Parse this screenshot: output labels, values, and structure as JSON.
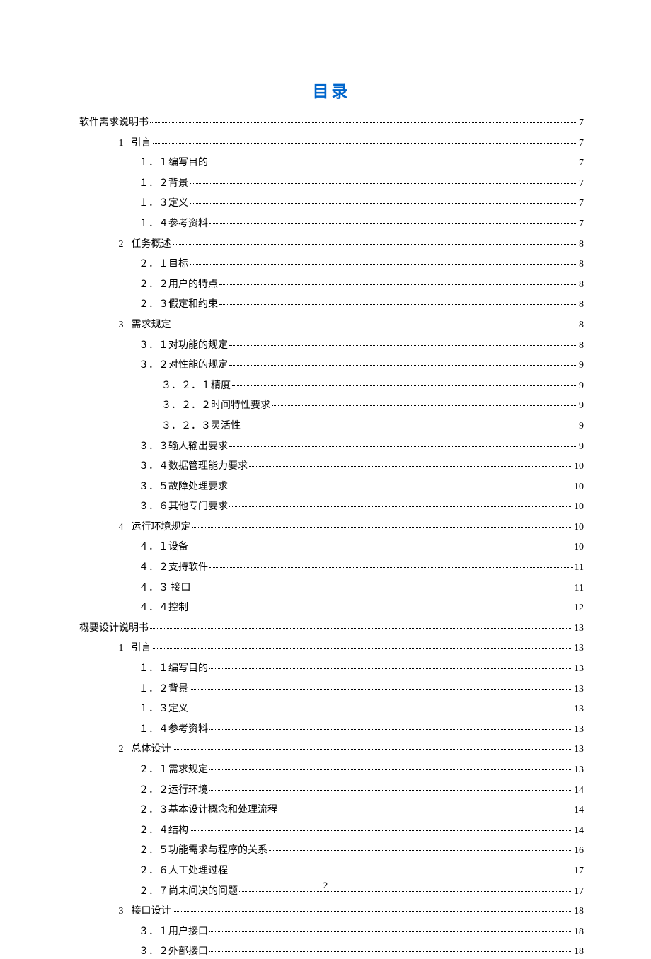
{
  "title": "目录",
  "page_number": "2",
  "entries": [
    {
      "level": 0,
      "label": "软件需求说明书",
      "page": "7"
    },
    {
      "level": 1,
      "num": "1",
      "label": "引言",
      "page": "7"
    },
    {
      "level": 2,
      "label": "１．１编写目的",
      "page": "7"
    },
    {
      "level": 2,
      "label": "１．２背景",
      "page": "7"
    },
    {
      "level": 2,
      "label": "１．３定义",
      "page": "7"
    },
    {
      "level": 2,
      "label": "１．４参考资料",
      "page": "7"
    },
    {
      "level": 1,
      "num": "2",
      "label": "任务概述",
      "page": "8"
    },
    {
      "level": 2,
      "label": "２．１目标",
      "page": "8"
    },
    {
      "level": 2,
      "label": "２．２用户的特点",
      "page": "8"
    },
    {
      "level": 2,
      "label": "２．３假定和约束",
      "page": "8"
    },
    {
      "level": 1,
      "num": "3",
      "label": "需求规定",
      "page": "8"
    },
    {
      "level": 2,
      "label": "３．１对功能的规定",
      "page": "8"
    },
    {
      "level": 2,
      "label": "３．２对性能的规定",
      "page": "9"
    },
    {
      "level": 3,
      "label": "３．２．１精度",
      "page": "9"
    },
    {
      "level": 3,
      "label": "３．２．２时间特性要求",
      "page": "9"
    },
    {
      "level": 3,
      "label": "３．２．３灵活性",
      "page": "9"
    },
    {
      "level": 2,
      "label": "３．３输人输出要求",
      "page": "9"
    },
    {
      "level": 2,
      "label": "３．４数据管理能力要求",
      "page": "10"
    },
    {
      "level": 2,
      "label": "３．５故障处理要求",
      "page": "10"
    },
    {
      "level": 2,
      "label": "３．６其他专门要求",
      "page": "10"
    },
    {
      "level": 1,
      "num": "4",
      "label": "运行环境规定",
      "page": "10"
    },
    {
      "level": 2,
      "label": "４．１设备",
      "page": "10"
    },
    {
      "level": 2,
      "label": "４．２支持软件",
      "page": "11"
    },
    {
      "level": 2,
      "label": "４．３ 接口",
      "page": "11"
    },
    {
      "level": 2,
      "label": "４．４控制",
      "page": "12"
    },
    {
      "level": 0,
      "label": "概要设计说明书",
      "page": "13"
    },
    {
      "level": 1,
      "num": "1",
      "label": "引言",
      "page": "13"
    },
    {
      "level": 2,
      "label": "１．１编写目的",
      "page": "13"
    },
    {
      "level": 2,
      "label": "１．２背景",
      "page": "13"
    },
    {
      "level": 2,
      "label": "１．３定义",
      "page": "13"
    },
    {
      "level": 2,
      "label": "１．４参考资料",
      "page": "13"
    },
    {
      "level": 1,
      "num": "2",
      "label": "总体设计",
      "page": "13"
    },
    {
      "level": 2,
      "label": "２．１需求规定",
      "page": "13"
    },
    {
      "level": 2,
      "label": "２．２运行环境",
      "page": "14"
    },
    {
      "level": 2,
      "label": "２．３基本设计概念和处理流程",
      "page": "14"
    },
    {
      "level": 2,
      "label": "２．４结构",
      "page": "14"
    },
    {
      "level": 2,
      "label": "２．５功能需求与程序的关系",
      "page": "16"
    },
    {
      "level": 2,
      "label": "２．６人工处理过程",
      "page": "17"
    },
    {
      "level": 2,
      "label": "２．７尚未问决的问题",
      "page": "17"
    },
    {
      "level": 1,
      "num": "3",
      "label": "接口设计",
      "page": "18"
    },
    {
      "level": 2,
      "label": "３．１用户接口",
      "page": "18"
    },
    {
      "level": 2,
      "label": "３．２外部接口",
      "page": "18"
    }
  ]
}
